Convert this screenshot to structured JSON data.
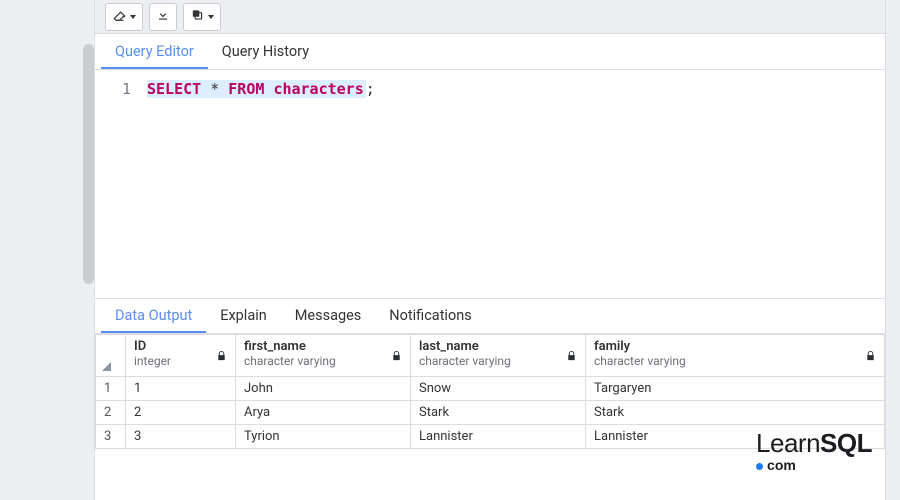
{
  "toolbar": {
    "clear_tooltip": "Clear",
    "download_tooltip": "Download",
    "copy_tooltip": "Copy"
  },
  "query_tabs": {
    "editor": "Query Editor",
    "history": "Query History"
  },
  "editor": {
    "lineno_1": "1",
    "kw_select": "SELECT",
    "op_star": "*",
    "kw_from": "FROM",
    "ident": "characters",
    "semi": ";"
  },
  "result_tabs": {
    "data_output": "Data Output",
    "explain": "Explain",
    "messages": "Messages",
    "notifications": "Notifications"
  },
  "columns": [
    {
      "name": "ID",
      "type": "integer"
    },
    {
      "name": "first_name",
      "type": "character varying"
    },
    {
      "name": "last_name",
      "type": "character varying"
    },
    {
      "name": "family",
      "type": "character varying"
    }
  ],
  "rows": [
    {
      "n": "1",
      "id": "1",
      "first_name": "John",
      "last_name": "Snow",
      "family": "Targaryen"
    },
    {
      "n": "2",
      "id": "2",
      "first_name": "Arya",
      "last_name": "Stark",
      "family": "Stark"
    },
    {
      "n": "3",
      "id": "3",
      "first_name": "Tyrion",
      "last_name": "Lannister",
      "family": "Lannister"
    }
  ],
  "logo": {
    "line1a": "Learn",
    "line1b": "SQL",
    "line2": "com"
  }
}
